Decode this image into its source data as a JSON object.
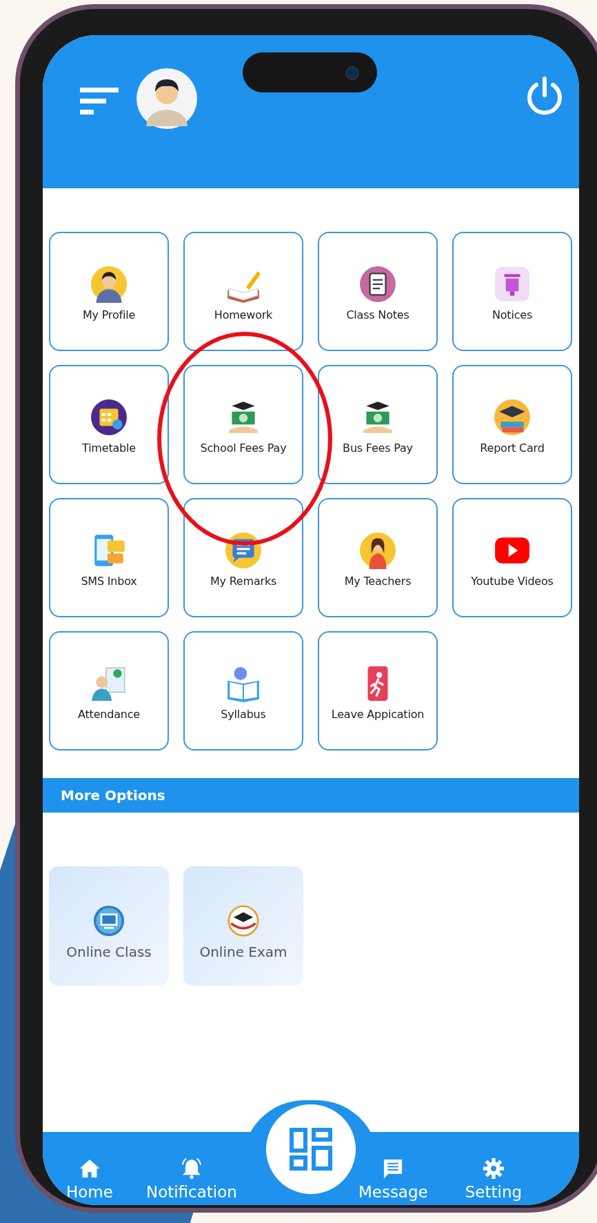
{
  "tiles": [
    {
      "label": "My Profile"
    },
    {
      "label": "Homework"
    },
    {
      "label": "Class Notes"
    },
    {
      "label": "Notices"
    },
    {
      "label": "Timetable"
    },
    {
      "label": "School Fees Pay"
    },
    {
      "label": "Bus Fees Pay"
    },
    {
      "label": "Report Card"
    },
    {
      "label": "SMS Inbox"
    },
    {
      "label": "My Remarks"
    },
    {
      "label": "My Teachers"
    },
    {
      "label": "Youtube Videos"
    },
    {
      "label": "Attendance"
    },
    {
      "label": "Syllabus"
    },
    {
      "label": "Leave Appication"
    }
  ],
  "more_options": {
    "title": "More Options",
    "items": [
      {
        "label": "Online Class"
      },
      {
        "label": "Online Exam"
      }
    ]
  },
  "bottom_nav": [
    {
      "label": "Home"
    },
    {
      "label": "Notification"
    },
    {
      "label": "Message"
    },
    {
      "label": "Setting"
    }
  ]
}
